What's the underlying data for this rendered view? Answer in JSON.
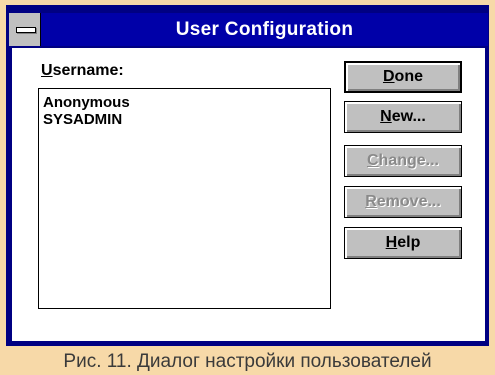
{
  "window": {
    "title": "User Configuration"
  },
  "username": {
    "label_u": "U",
    "label_rest": "sername:"
  },
  "list": {
    "items": [
      "Anonymous",
      "SYSADMIN"
    ]
  },
  "buttons": {
    "done_u": "D",
    "done_rest": "one",
    "new_u": "N",
    "new_rest": "ew...",
    "change_u": "C",
    "change_rest": "hange...",
    "remove_u": "R",
    "remove_rest": "emove...",
    "help_u": "H",
    "help_rest": "elp"
  },
  "caption": "Рис. 11. Диалог настройки пользователей"
}
